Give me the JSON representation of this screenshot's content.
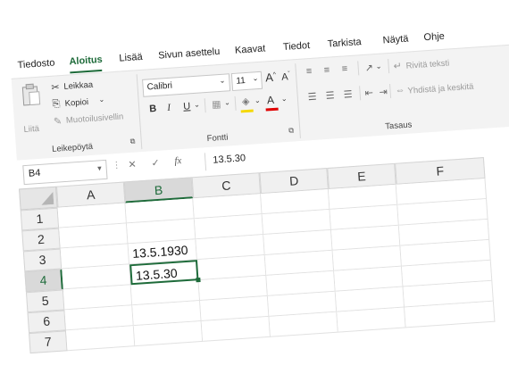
{
  "tabs": [
    "Tiedosto",
    "Aloitus",
    "Lisää",
    "Sivun asettelu",
    "Kaavat",
    "Tiedot",
    "Tarkista",
    "Näytä",
    "Ohje"
  ],
  "active_tab": "Aloitus",
  "clipboard": {
    "paste_label": "Liitä",
    "cut_label": "Leikkaa",
    "copy_label": "Kopioi",
    "format_painter_label": "Muotoilusivellin",
    "group_label": "Leikepöytä"
  },
  "font": {
    "name": "Calibri",
    "size": "11",
    "bold": "B",
    "italic": "I",
    "underline": "U",
    "font_color_glyph": "A",
    "grow": "A",
    "shrink": "A",
    "group_label": "Fontti"
  },
  "alignment": {
    "wrap_label": "Rivitä teksti",
    "merge_label": "Yhdistä ja keskitä",
    "group_label": "Tasaus"
  },
  "formula_bar": {
    "name_box": "B4",
    "fx": "fx",
    "formula": "13.5.30"
  },
  "columns": [
    "A",
    "B",
    "C",
    "D",
    "E",
    "F"
  ],
  "rows": [
    "1",
    "2",
    "3",
    "4",
    "5",
    "6",
    "7"
  ],
  "selected_cell": "B4",
  "cells": {
    "B3": "13.5.1930",
    "B4": "13.5.30"
  }
}
